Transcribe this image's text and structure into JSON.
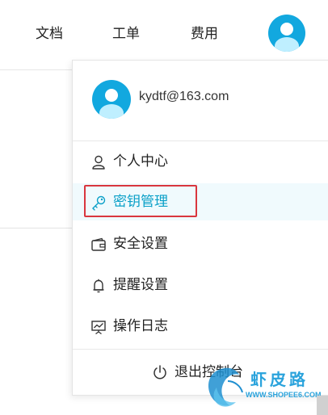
{
  "nav": {
    "docs": "文档",
    "tickets": "工单",
    "costs": "费用"
  },
  "dropdown": {
    "email": "kydtf@163.com",
    "items": [
      {
        "label": "个人中心",
        "icon": "user-icon"
      },
      {
        "label": "密钥管理",
        "icon": "key-icon"
      },
      {
        "label": "安全设置",
        "icon": "wallet-icon"
      },
      {
        "label": "提醒设置",
        "icon": "bell-icon"
      },
      {
        "label": "操作日志",
        "icon": "chart-board-icon"
      }
    ],
    "active_index": 1,
    "logout": "退出控制台"
  },
  "watermark": {
    "text": "虾皮路",
    "url": "WWW.SHOPEE6.COM"
  },
  "colors": {
    "accent": "#12a8df",
    "active_text": "#0aa0c8",
    "highlight_border": "#d9363e"
  }
}
